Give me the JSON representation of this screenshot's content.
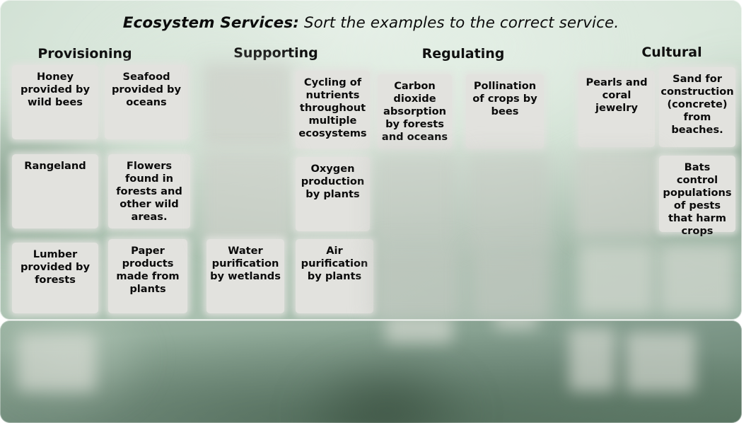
{
  "header": {
    "title_lead": "Ecosystem Services:",
    "title_rest": " Sort the examples to the correct service.",
    "title_full": "Ecosystem Services: Sort the examples to the correct service."
  },
  "columns": [
    {
      "id": "provisioning",
      "label": "Provisioning"
    },
    {
      "id": "supporting",
      "label": "Supporting"
    },
    {
      "id": "regulating",
      "label": "Regulating"
    },
    {
      "id": "cultural",
      "label": "Cultural"
    }
  ],
  "cards": {
    "provisioning": [
      "Honey provided by wild bees",
      "Seafood provided by oceans",
      "Rangeland",
      "Flowers found in forests and other wild areas.",
      "Lumber provided by forests",
      "Paper products made from plants"
    ],
    "supporting": [
      "Cycling of nutrients throughout multiple ecosystems",
      "Oxygen production by plants",
      "Water purification by wetlands",
      "Air purification by plants"
    ],
    "regulating": [
      "Carbon dioxide absorption by forests and oceans",
      "Pollination of crops by bees"
    ],
    "cultural": [
      "Pearls and coral jewelry",
      "Sand for construction (concrete) from beaches.",
      "Bats control populations of pests that harm crops"
    ]
  },
  "labels": {
    "c_honey": "Honey provided by wild bees",
    "c_seafood": "Seafood provided by oceans",
    "c_rangeland": "Rangeland",
    "c_flowers": "Flowers found in forests and other wild areas.",
    "c_lumber": "Lumber provided by forests",
    "c_paper": "Paper products made from plants",
    "c_cycling": "Cycling of nutrients throughout multiple ecosystems",
    "c_oxygen": "Oxygen production by plants",
    "c_water": "Water purification by wetlands",
    "c_air": "Air purification by plants",
    "c_carbon": "Carbon dioxide absorption by forests and oceans",
    "c_pollination": "Pollination of crops by bees",
    "c_pearls": "Pearls and coral jewelry",
    "c_sand": "Sand for construction (concrete) from beaches.",
    "c_bats": "Bats control populations of pests that harm crops"
  },
  "colors": {
    "card_fill": "#e2e2de",
    "board_green": "#b2c7b8",
    "tray_green": "#7d9788",
    "text": "#0b0b0b"
  }
}
